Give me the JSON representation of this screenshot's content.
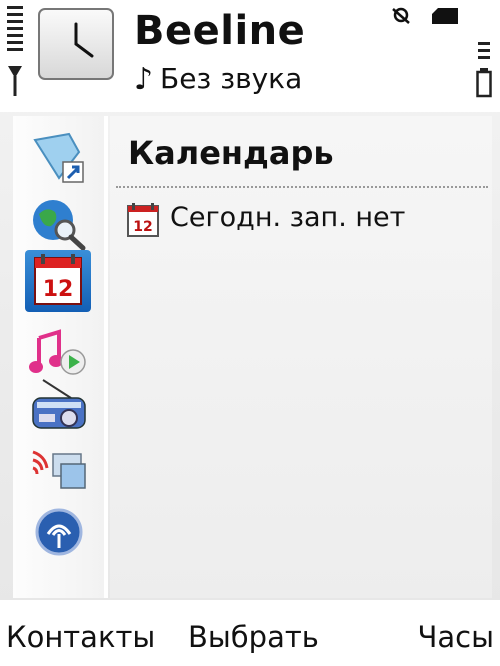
{
  "status": {
    "operator": "Beeline",
    "profile": "Без звука",
    "profile_icon": "♪"
  },
  "sidebar": {
    "items": [
      {
        "name": "shortcuts-icon"
      },
      {
        "name": "web-search-icon"
      },
      {
        "name": "calendar-icon",
        "selected": true,
        "day": "12"
      },
      {
        "name": "music-player-icon"
      },
      {
        "name": "radio-icon"
      },
      {
        "name": "share-online-icon"
      },
      {
        "name": "connectivity-icon"
      }
    ]
  },
  "content": {
    "title": "Календарь",
    "rows": [
      {
        "icon_day": "12",
        "text": "Сегодн. зап. нет"
      }
    ]
  },
  "softkeys": {
    "left": "Контакты",
    "center": "Выбрать",
    "right": "Часы"
  }
}
